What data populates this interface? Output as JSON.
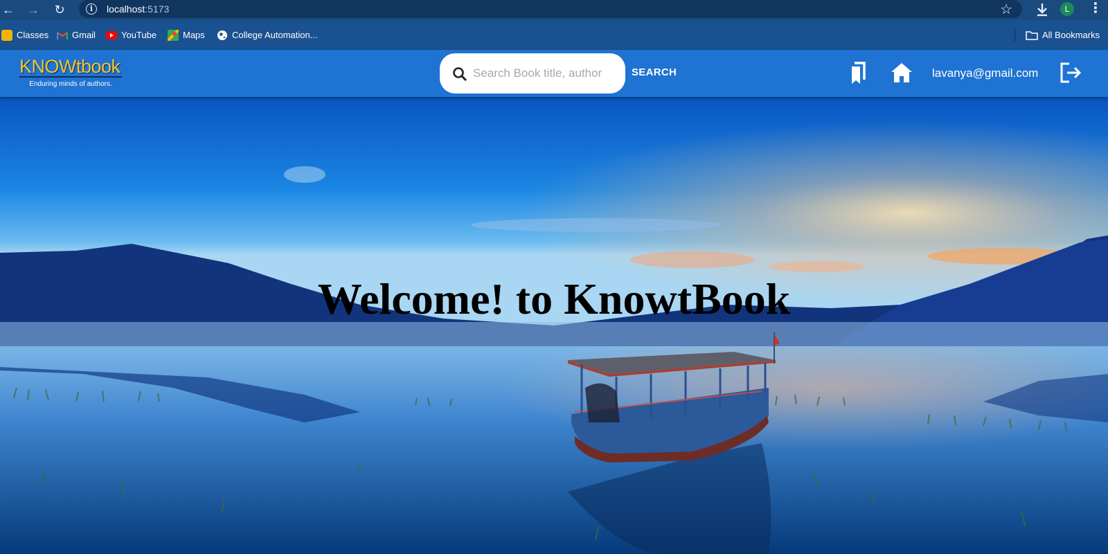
{
  "browser": {
    "url_host": "localhost",
    "url_port": ":5173",
    "avatar_letter": "L",
    "icons": [
      "back-icon",
      "forward-icon",
      "reload-icon",
      "info-icon",
      "star-icon",
      "download-icon",
      "menu-icon"
    ],
    "bookmarks": [
      {
        "label": "Classes",
        "icon": "classroom-icon",
        "color": "#f2b400"
      },
      {
        "label": "Gmail",
        "icon": "gmail-icon",
        "color": "#ea4335"
      },
      {
        "label": "YouTube",
        "icon": "youtube-icon",
        "color": "#ff0000"
      },
      {
        "label": "Maps",
        "icon": "maps-icon",
        "color": "#34a853"
      },
      {
        "label": "College Automation...",
        "icon": "globe-icon",
        "color": "#ffffff"
      }
    ],
    "all_bookmarks_label": "All Bookmarks"
  },
  "app": {
    "logo_title": "KNOWtbook",
    "logo_tagline": "Enduring minds of authors.",
    "search_placeholder": "Search Book title, author",
    "search_value": "",
    "search_button": "SEARCH",
    "user_email": "lavanya@gmail.com",
    "header_icons": [
      "bookmarks-icon",
      "home-icon",
      "logout-icon"
    ],
    "colors": {
      "header": "#1f73d2",
      "logo": "#f7c52a",
      "chrome": "#1a4a7e",
      "bookmarks_bar": "#1a5190"
    }
  },
  "hero": {
    "title": "Welcome! to KnowtBook"
  }
}
